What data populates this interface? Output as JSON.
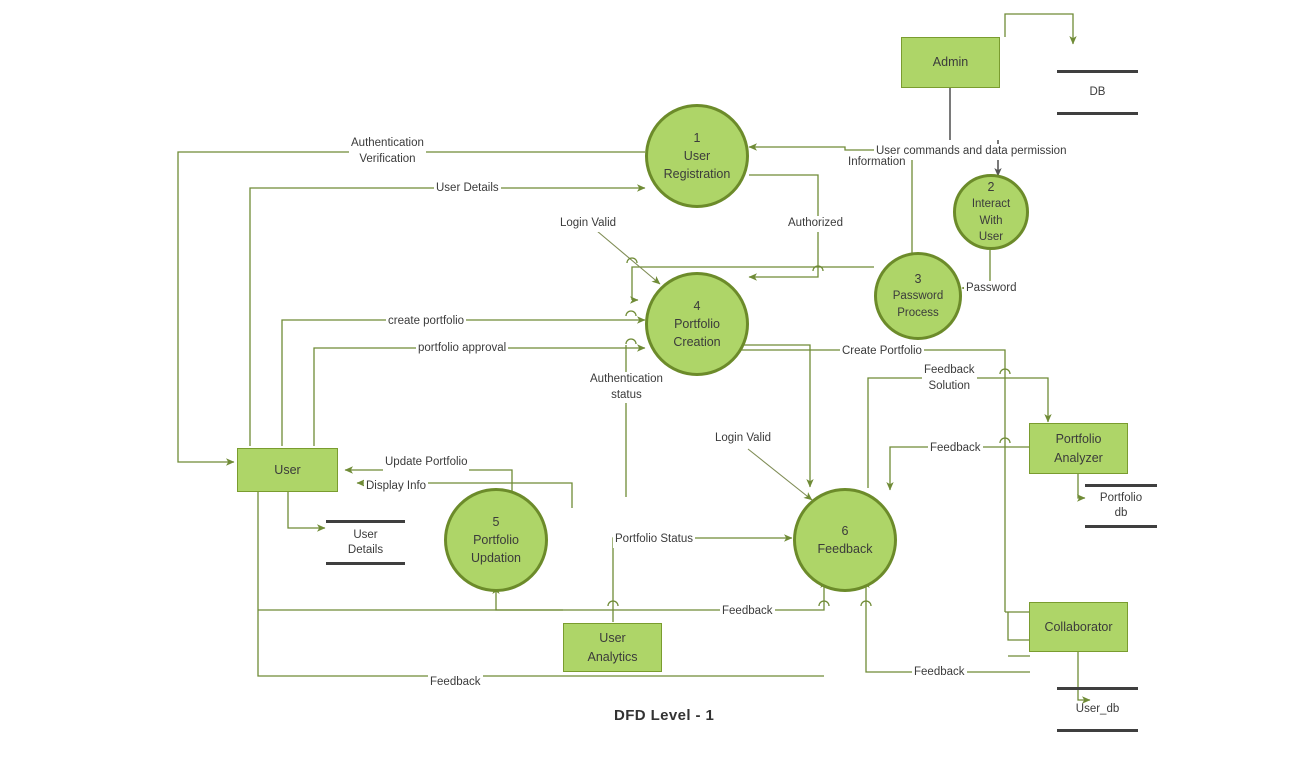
{
  "diagram": {
    "title": "DFD Level - 1",
    "colors": {
      "fill": "#aed568",
      "process_border": "#6c8b2a",
      "entity_border": "#7a9c2f",
      "wire": "#6f8b36",
      "store_bar": "#3f3f3f",
      "text": "#3b3b3b"
    }
  },
  "entities": [
    {
      "id": "admin",
      "label": "Admin"
    },
    {
      "id": "user",
      "label": "User"
    },
    {
      "id": "portfolio_analyzer",
      "label": "Portfolio\nAnalyzer",
      "line1": "Portfolio",
      "line2": "Analyzer"
    },
    {
      "id": "user_analytics",
      "label": "User\nAnalytics",
      "line1": "User",
      "line2": "Analytics"
    },
    {
      "id": "collaborator",
      "label": "Collaborator"
    }
  ],
  "processes": [
    {
      "id": "p1",
      "num": "1",
      "line1": "User",
      "line2": "Registration"
    },
    {
      "id": "p2",
      "num": "2",
      "line1": "Interact",
      "line2": "With",
      "line3": "User"
    },
    {
      "id": "p3",
      "num": "3",
      "line1": "Password",
      "line2": "Process"
    },
    {
      "id": "p4",
      "num": "4",
      "line1": "Portfolio",
      "line2": "Creation"
    },
    {
      "id": "p5",
      "num": "5",
      "line1": "Portfolio",
      "line2": "Updation"
    },
    {
      "id": "p6",
      "num": "6",
      "line1": "Feedback"
    }
  ],
  "stores": [
    {
      "id": "db",
      "line1": "DB"
    },
    {
      "id": "user_details",
      "line1": "User",
      "line2": "Details"
    },
    {
      "id": "portfolio_db",
      "line1": "Portfolio",
      "line2": "db"
    },
    {
      "id": "user_db",
      "line1": "User_db"
    }
  ],
  "flows": [
    {
      "id": "f_auth_verif",
      "line1": "Authentication",
      "line2": "Verification"
    },
    {
      "id": "f_user_details",
      "line1": "User Details"
    },
    {
      "id": "f_login_valid_1",
      "line1": "Login  Valid"
    },
    {
      "id": "f_authorized",
      "line1": "Authorized"
    },
    {
      "id": "f_user_commands",
      "line1": "User commands and data permission"
    },
    {
      "id": "f_information",
      "line1": "Information"
    },
    {
      "id": "f_password",
      "line1": "Password"
    },
    {
      "id": "f_create_portfolio_low",
      "line1": "create portfolio"
    },
    {
      "id": "f_portfolio_approval",
      "line1": "portfolio approval"
    },
    {
      "id": "f_auth_status",
      "line1": "Authentication",
      "line2": "status"
    },
    {
      "id": "f_create_portfolio_cap",
      "line1": "Create Portfolio"
    },
    {
      "id": "f_feedback_solution",
      "line1": "Feedback",
      "line2": "Solution"
    },
    {
      "id": "f_feedback_analyzer",
      "line1": "Feedback"
    },
    {
      "id": "f_update_portfolio",
      "line1": "Update Portfolio"
    },
    {
      "id": "f_display_info",
      "line1": "Display Info"
    },
    {
      "id": "f_login_valid_2",
      "line1": "Login  Valid"
    },
    {
      "id": "f_portfolio_status",
      "line1": "Portfolio Status"
    },
    {
      "id": "f_feedback_mid",
      "line1": "Feedback"
    },
    {
      "id": "f_feedback_collab",
      "line1": "Feedback"
    },
    {
      "id": "f_feedback_bottom",
      "line1": "Feedback"
    }
  ]
}
